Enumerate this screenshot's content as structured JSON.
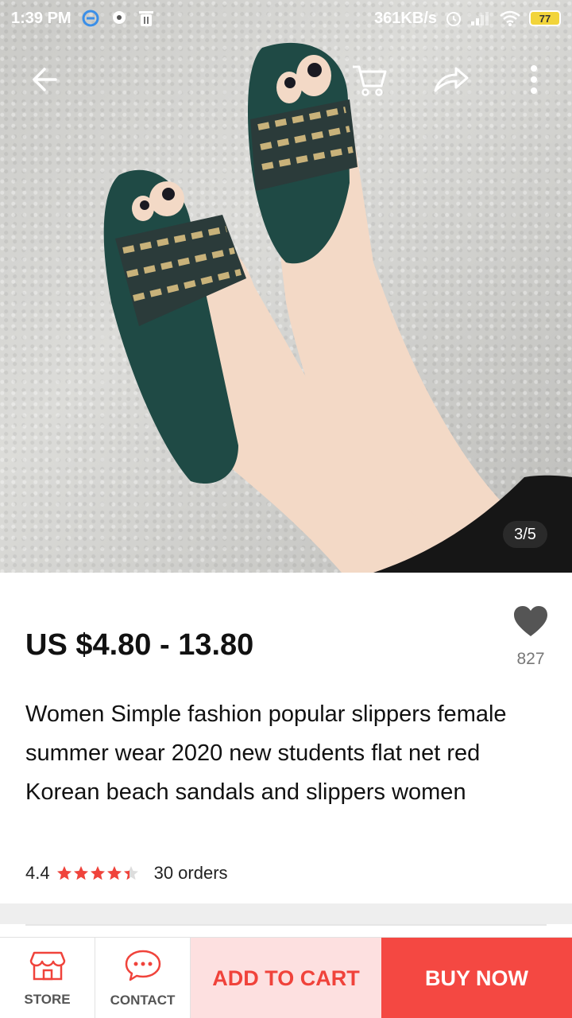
{
  "status_bar": {
    "time": "1:39 PM",
    "network_speed": "361KB/s",
    "battery": "77"
  },
  "hero": {
    "image_alt_icon": "product-photo-sandals",
    "pager": "3/5"
  },
  "product": {
    "price": "US $4.80 - 13.80",
    "wishlist_count": "827",
    "title": "Women Simple fashion popular slippers female summer wear 2020 new students flat net red Korean beach sandals and slippers women",
    "rating": "4.4",
    "rating_value": 4.4,
    "rating_max": 5,
    "orders": "30 orders"
  },
  "bottom_bar": {
    "store_label": "STORE",
    "contact_label": "CONTACT",
    "add_to_cart_label": "ADD TO CART",
    "buy_now_label": "BUY NOW"
  },
  "colors": {
    "accent": "#f44842",
    "accent_light": "#fde0e0",
    "star": "#f0433b",
    "sandal": "#1f4a45"
  }
}
